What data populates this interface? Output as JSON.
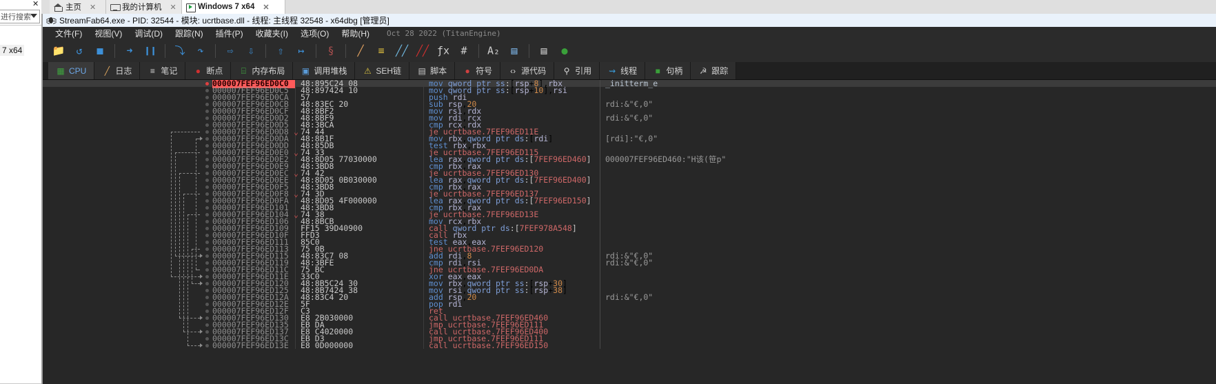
{
  "explorer": {
    "close_label": "✕",
    "search_placeholder": "进行搜索",
    "item_label": "7 x64"
  },
  "browser_tabs": [
    {
      "label": "主页",
      "icon": "home-icon",
      "close": "✕",
      "active": false
    },
    {
      "label": "我的计算机",
      "icon": "monitor-icon",
      "close": "✕",
      "active": false
    },
    {
      "label": "Windows 7 x64",
      "icon": "window-play-icon",
      "close": "✕",
      "active": true
    }
  ],
  "window": {
    "title": "StreamFab64.exe - PID: 32544 - 模块: ucrtbase.dll - 线程: 主线程 32548 - x64dbg [管理员]",
    "icon": "bug-icon"
  },
  "menu": {
    "items": [
      "文件(F)",
      "视图(V)",
      "调试(D)",
      "跟踪(N)",
      "插件(P)",
      "收藏夹(I)",
      "选项(O)",
      "帮助(H)"
    ],
    "build_stamp": "Oct 28 2022 (TitanEngine)"
  },
  "toolbar": {
    "buttons": [
      {
        "name": "open-icon",
        "glyph": "📁",
        "color": "#e0b030"
      },
      {
        "name": "restart-icon",
        "glyph": "↺",
        "color": "#3d90d8"
      },
      {
        "name": "stop-icon",
        "glyph": "■",
        "color": "#3d90d8"
      },
      {
        "name": "sep",
        "glyph": "",
        "color": ""
      },
      {
        "name": "run-icon",
        "glyph": "➜",
        "color": "#3d90d8"
      },
      {
        "name": "pause-icon",
        "glyph": "❙❙",
        "color": "#3d90d8"
      },
      {
        "name": "sep",
        "glyph": "",
        "color": ""
      },
      {
        "name": "step-into-icon",
        "glyph": "⤵",
        "color": "#3d90d8"
      },
      {
        "name": "step-over-icon",
        "glyph": "↷",
        "color": "#3d90d8"
      },
      {
        "name": "sep",
        "glyph": "",
        "color": ""
      },
      {
        "name": "step-into-fast-icon",
        "glyph": "⇨",
        "color": "#3d90d8"
      },
      {
        "name": "step-over-fast-icon",
        "glyph": "⇩",
        "color": "#3d90d8"
      },
      {
        "name": "sep",
        "glyph": "",
        "color": ""
      },
      {
        "name": "execute-till-return-icon",
        "glyph": "⇧",
        "color": "#3d90d8"
      },
      {
        "name": "run-to-user-code-icon",
        "glyph": "↦",
        "color": "#3d90d8"
      },
      {
        "name": "sep",
        "glyph": "",
        "color": ""
      },
      {
        "name": "skip-icon",
        "glyph": "§",
        "color": "#b05050"
      },
      {
        "name": "sep",
        "glyph": "",
        "color": ""
      },
      {
        "name": "log-icon",
        "glyph": "╱",
        "color": "#e0a060"
      },
      {
        "name": "notes-icon",
        "glyph": "≡",
        "color": "#e0c040"
      },
      {
        "name": "breakpoints-icon",
        "glyph": "╱╱",
        "color": "#70b8e0"
      },
      {
        "name": "memory-map-icon",
        "glyph": "╱╱",
        "color": "#d03030"
      },
      {
        "name": "fx-icon",
        "glyph": "ƒx",
        "color": "#cfcfcf"
      },
      {
        "name": "hash-icon",
        "glyph": "#",
        "color": "#cfcfcf"
      },
      {
        "name": "sep",
        "glyph": "",
        "color": ""
      },
      {
        "name": "font-icon",
        "glyph": "A₂",
        "color": "#cfcfcf"
      },
      {
        "name": "calculator-plus-icon",
        "glyph": "▤",
        "color": "#7ab0e0"
      },
      {
        "name": "sep",
        "glyph": "",
        "color": ""
      },
      {
        "name": "calculator-icon",
        "glyph": "▤",
        "color": "#c8c8c8"
      },
      {
        "name": "donate-icon",
        "glyph": "●",
        "color": "#3aa03a"
      }
    ]
  },
  "tabs": [
    {
      "label": "CPU",
      "icon": "cpu-icon",
      "active": true
    },
    {
      "label": "日志",
      "icon": "log-icon",
      "active": false
    },
    {
      "label": "笔记",
      "icon": "notes-icon",
      "active": false
    },
    {
      "label": "断点",
      "icon": "breakpoint-icon",
      "active": false
    },
    {
      "label": "内存布局",
      "icon": "memory-icon",
      "active": false
    },
    {
      "label": "调用堆栈",
      "icon": "callstack-icon",
      "active": false
    },
    {
      "label": "SEH链",
      "icon": "seh-icon",
      "active": false
    },
    {
      "label": "脚本",
      "icon": "script-icon",
      "active": false
    },
    {
      "label": "符号",
      "icon": "symbols-icon",
      "active": false
    },
    {
      "label": "源代码",
      "icon": "source-icon",
      "active": false
    },
    {
      "label": "引用",
      "icon": "references-icon",
      "active": false
    },
    {
      "label": "线程",
      "icon": "threads-icon",
      "active": false
    },
    {
      "label": "句柄",
      "icon": "handles-icon",
      "active": false
    },
    {
      "label": "跟踪",
      "icon": "trace-icon",
      "active": false
    }
  ],
  "disassembly": {
    "rows": [
      {
        "addr": "000007FEF96ED0C0",
        "bytes": "48:895C24 08",
        "check": "",
        "mnem": "mov",
        "args": " qword ptr ss:[rsp+8],rbx",
        "kind": "mov",
        "comment": "_initterm_e",
        "current": true
      },
      {
        "addr": "000007FEF96ED0C5",
        "bytes": "48:897424 10",
        "check": "",
        "mnem": "mov",
        "args": " qword ptr ss:[rsp+10],rsi",
        "kind": "mov",
        "comment": "",
        "current": false
      },
      {
        "addr": "000007FEF96ED0CA",
        "bytes": "57",
        "check": "",
        "mnem": "push",
        "args": " rdi",
        "kind": "mov",
        "comment": "",
        "current": false
      },
      {
        "addr": "000007FEF96ED0CB",
        "bytes": "48:83EC 20",
        "check": "",
        "mnem": "sub",
        "args": " rsp,20",
        "kind": "mov",
        "comment": "rdi:&\"€,0\"",
        "current": false
      },
      {
        "addr": "000007FEF96ED0CF",
        "bytes": "48:8BF2",
        "check": "",
        "mnem": "mov",
        "args": " rsi,rdx",
        "kind": "mov",
        "comment": "",
        "current": false
      },
      {
        "addr": "000007FEF96ED0D2",
        "bytes": "48:8BF9",
        "check": "",
        "mnem": "mov",
        "args": " rdi,rcx",
        "kind": "mov",
        "comment": "rdi:&\"€,0\"",
        "current": false
      },
      {
        "addr": "000007FEF96ED0D5",
        "bytes": "48:3BCA",
        "check": "",
        "mnem": "cmp",
        "args": " rcx,rdx",
        "kind": "mov",
        "comment": "",
        "current": false
      },
      {
        "addr": "000007FEF96ED0D8",
        "bytes": "74 44",
        "check": "⌄",
        "mnem": "je",
        "args": " ucrtbase.7FEF96ED11E",
        "kind": "jmp",
        "comment": "",
        "current": false
      },
      {
        "addr": "000007FEF96ED0DA",
        "bytes": "48:8B1F",
        "check": "",
        "mnem": "mov",
        "args": " rbx,qword ptr ds:[rdi]",
        "kind": "mov",
        "comment": "[rdi]:\"€,0\"",
        "current": false
      },
      {
        "addr": "000007FEF96ED0DD",
        "bytes": "48:85DB",
        "check": "",
        "mnem": "test",
        "args": " rbx,rbx",
        "kind": "mov",
        "comment": "",
        "current": false
      },
      {
        "addr": "000007FEF96ED0E0",
        "bytes": "74 33",
        "check": "⌄",
        "mnem": "je",
        "args": " ucrtbase.7FEF96ED115",
        "kind": "jmp",
        "comment": "",
        "current": false
      },
      {
        "addr": "000007FEF96ED0E2",
        "bytes": "48:8D05 77030000",
        "check": "",
        "mnem": "lea",
        "args": " rax,qword ptr ds:[7FEF96ED460]",
        "kind": "mov",
        "comment": "000007FEF96ED460:\"H该(笹p\"",
        "current": false
      },
      {
        "addr": "000007FEF96ED0E9",
        "bytes": "48:3BD8",
        "check": "",
        "mnem": "cmp",
        "args": " rbx,rax",
        "kind": "mov",
        "comment": "",
        "current": false
      },
      {
        "addr": "000007FEF96ED0EC",
        "bytes": "74 42",
        "check": "⌄",
        "mnem": "je",
        "args": " ucrtbase.7FEF96ED130",
        "kind": "jmp",
        "comment": "",
        "current": false
      },
      {
        "addr": "000007FEF96ED0EE",
        "bytes": "48:8D05 0B030000",
        "check": "",
        "mnem": "lea",
        "args": " rax,qword ptr ds:[7FEF96ED400]",
        "kind": "mov",
        "comment": "",
        "current": false
      },
      {
        "addr": "000007FEF96ED0F5",
        "bytes": "48:3BD8",
        "check": "",
        "mnem": "cmp",
        "args": " rbx,rax",
        "kind": "mov",
        "comment": "",
        "current": false
      },
      {
        "addr": "000007FEF96ED0F8",
        "bytes": "74 3D",
        "check": "⌄",
        "mnem": "je",
        "args": " ucrtbase.7FEF96ED137",
        "kind": "jmp",
        "comment": "",
        "current": false
      },
      {
        "addr": "000007FEF96ED0FA",
        "bytes": "48:8D05 4F000000",
        "check": "",
        "mnem": "lea",
        "args": " rax,qword ptr ds:[7FEF96ED150]",
        "kind": "mov",
        "comment": "",
        "current": false
      },
      {
        "addr": "000007FEF96ED101",
        "bytes": "48:3BD8",
        "check": "",
        "mnem": "cmp",
        "args": " rbx,rax",
        "kind": "mov",
        "comment": "",
        "current": false
      },
      {
        "addr": "000007FEF96ED104",
        "bytes": "74 38",
        "check": "⌄",
        "mnem": "je",
        "args": " ucrtbase.7FEF96ED13E",
        "kind": "jmp",
        "comment": "",
        "current": false
      },
      {
        "addr": "000007FEF96ED106",
        "bytes": "48:8BCB",
        "check": "",
        "mnem": "mov",
        "args": " rcx,rbx",
        "kind": "mov",
        "comment": "",
        "current": false
      },
      {
        "addr": "000007FEF96ED109",
        "bytes": "FF15 39D40900",
        "check": "",
        "mnem": "call",
        "args": " qword ptr ds:[7FEF978A548]",
        "kind": "jmp",
        "comment": "",
        "current": false
      },
      {
        "addr": "000007FEF96ED10F",
        "bytes": "FFD3",
        "check": "",
        "mnem": "call",
        "args": " rbx",
        "kind": "jmp",
        "comment": "",
        "current": false
      },
      {
        "addr": "000007FEF96ED111",
        "bytes": "85C0",
        "check": "",
        "mnem": "test",
        "args": " eax,eax",
        "kind": "mov",
        "comment": "",
        "current": false
      },
      {
        "addr": "000007FEF96ED113",
        "bytes": "75 0B",
        "check": "",
        "mnem": "jne",
        "args": " ucrtbase.7FEF96ED120",
        "kind": "jmp",
        "comment": "",
        "current": false
      },
      {
        "addr": "000007FEF96ED115",
        "bytes": "48:83C7 08",
        "check": "",
        "mnem": "add",
        "args": " rdi,8",
        "kind": "mov",
        "comment": "rdi:&\"€,0\"",
        "current": false
      },
      {
        "addr": "000007FEF96ED119",
        "bytes": "48:3BFE",
        "check": "",
        "mnem": "cmp",
        "args": " rdi,rsi",
        "kind": "mov",
        "comment": "rdi:&\"€,0\"",
        "current": false
      },
      {
        "addr": "000007FEF96ED11C",
        "bytes": "75 BC",
        "check": "",
        "mnem": "jne",
        "args": " ucrtbase.7FEF96ED0DA",
        "kind": "jmp",
        "comment": "",
        "current": false
      },
      {
        "addr": "000007FEF96ED11E",
        "bytes": "33C0",
        "check": "",
        "mnem": "xor",
        "args": " eax,eax",
        "kind": "mov",
        "comment": "",
        "current": false
      },
      {
        "addr": "000007FEF96ED120",
        "bytes": "48:8B5C24 30",
        "check": "",
        "mnem": "mov",
        "args": " rbx,qword ptr ss:[rsp+30]",
        "kind": "mov",
        "comment": "",
        "current": false
      },
      {
        "addr": "000007FEF96ED125",
        "bytes": "48:8B7424 38",
        "check": "",
        "mnem": "mov",
        "args": " rsi,qword ptr ss:[rsp+38]",
        "kind": "mov",
        "comment": "",
        "current": false
      },
      {
        "addr": "000007FEF96ED12A",
        "bytes": "48:83C4 20",
        "check": "",
        "mnem": "add",
        "args": " rsp,20",
        "kind": "mov",
        "comment": "rdi:&\"€,0\"",
        "current": false
      },
      {
        "addr": "000007FEF96ED12E",
        "bytes": "5F",
        "check": "",
        "mnem": "pop",
        "args": " rdi",
        "kind": "mov",
        "comment": "",
        "current": false
      },
      {
        "addr": "000007FEF96ED12F",
        "bytes": "C3",
        "check": "",
        "mnem": "ret",
        "args": "",
        "kind": "jmp",
        "comment": "",
        "current": false
      },
      {
        "addr": "000007FEF96ED130",
        "bytes": "E8 2B030000",
        "check": "",
        "mnem": "call",
        "args": " ucrtbase.7FEF96ED460",
        "kind": "jmp",
        "comment": "",
        "current": false
      },
      {
        "addr": "000007FEF96ED135",
        "bytes": "EB DA",
        "check": "",
        "mnem": "jmp",
        "args": " ucrtbase.7FEF96ED111",
        "kind": "jmp",
        "comment": "",
        "current": false
      },
      {
        "addr": "000007FEF96ED137",
        "bytes": "E8 C4020000",
        "check": "",
        "mnem": "call",
        "args": " ucrtbase.7FEF96ED400",
        "kind": "jmp",
        "comment": "",
        "current": false
      },
      {
        "addr": "000007FEF96ED13C",
        "bytes": "EB D3",
        "check": "",
        "mnem": "jmp",
        "args": " ucrtbase.7FEF96ED111",
        "kind": "jmp",
        "comment": "",
        "current": false
      },
      {
        "addr": "000007FEF96ED13E",
        "bytes": "E8 0D000000",
        "check": "",
        "mnem": "call",
        "args": " ucrtbase.7FEF96ED150",
        "kind": "jmp",
        "comment": "",
        "current": false
      }
    ]
  },
  "colors": {
    "window_bg": "#2b2b2b",
    "disasm_bg": "#272727",
    "current_row": "#ff5b5b",
    "mov_color": "#5f8fd0",
    "jmp_color": "#cf6868",
    "number_color": "#d08a4a",
    "comment_color": "#9a9a9a"
  }
}
